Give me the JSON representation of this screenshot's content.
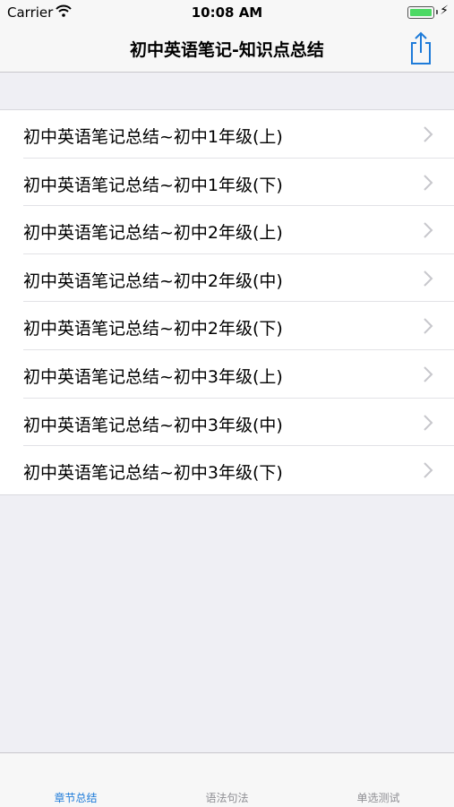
{
  "status_bar": {
    "carrier": "Carrier",
    "time": "10:08 AM",
    "wifi_icon": "wifi-icon",
    "battery_icon": "battery-icon",
    "charging_icon": "bolt-icon"
  },
  "nav": {
    "title": "初中英语笔记-知识点总结",
    "share_icon": "share-icon",
    "accent_color": "#1e7bd9"
  },
  "list": {
    "items": [
      {
        "label": "初中英语笔记总结~初中1年级(上)"
      },
      {
        "label": "初中英语笔记总结~初中1年级(下)"
      },
      {
        "label": "初中英语笔记总结~初中2年级(上)"
      },
      {
        "label": "初中英语笔记总结~初中2年级(中)"
      },
      {
        "label": "初中英语笔记总结~初中2年级(下)"
      },
      {
        "label": "初中英语笔记总结~初中3年级(上)"
      },
      {
        "label": "初中英语笔记总结~初中3年级(中)"
      },
      {
        "label": "初中英语笔记总结~初中3年级(下)"
      }
    ],
    "chevron_icon": "chevron-right-icon"
  },
  "tabs": [
    {
      "label": "章节总结",
      "active": true
    },
    {
      "label": "语法句法",
      "active": false
    },
    {
      "label": "单选测试",
      "active": false
    }
  ]
}
